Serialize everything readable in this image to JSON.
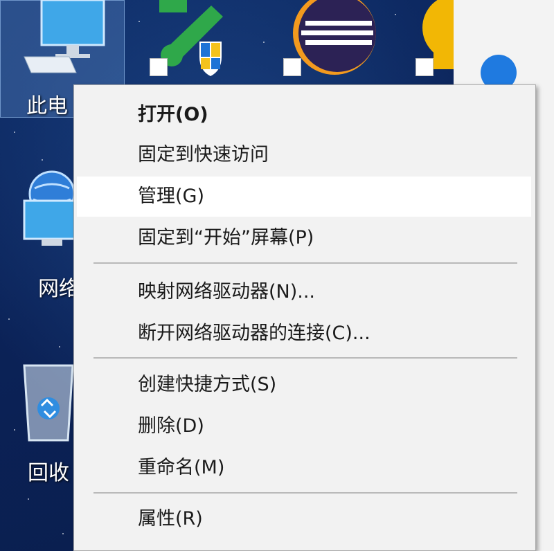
{
  "desktop": {
    "icons": {
      "this_pc": "此电",
      "network": "网络",
      "recycle_bin": "回收"
    }
  },
  "context_menu": {
    "items": [
      {
        "label": "打开(O)",
        "bold": true
      },
      {
        "label": "固定到快速访问"
      },
      {
        "label": "管理(G)",
        "hovered": true
      },
      {
        "label": "固定到“开始”屏幕(P)"
      },
      {
        "label": "映射网络驱动器(N)..."
      },
      {
        "label": "断开网络驱动器的连接(C)..."
      },
      {
        "label": "创建快捷方式(S)"
      },
      {
        "label": "删除(D)"
      },
      {
        "label": "重命名(M)"
      },
      {
        "label": "属性(R)"
      }
    ]
  },
  "colors": {
    "menu_background": "#f2f2f2",
    "menu_hover": "#ffffff",
    "desktop_background": "#0b2257",
    "selection": "#78aae6"
  }
}
